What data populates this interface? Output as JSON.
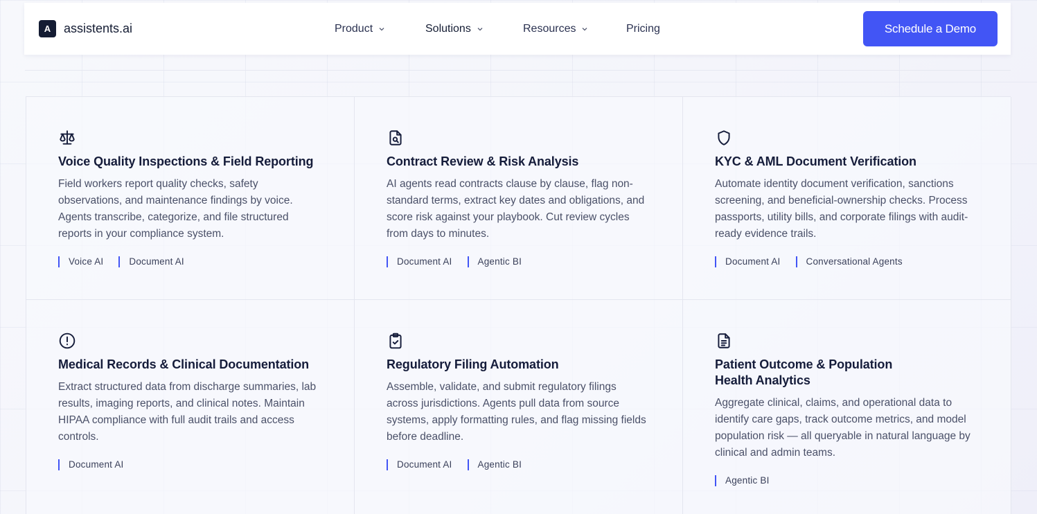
{
  "brand": {
    "mark": "A",
    "name": "assistents.ai"
  },
  "nav": {
    "items": [
      {
        "label": "Product"
      },
      {
        "label": "Solutions"
      },
      {
        "label": "Resources"
      },
      {
        "label": "Pricing"
      }
    ],
    "cta": "Schedule a Demo"
  },
  "colors": {
    "accent": "#4255f5",
    "ink": "#151c3a"
  },
  "cards": [
    {
      "icon": "scales-icon",
      "title": "Voice Quality Inspections & Field Reporting",
      "desc": "Field workers report quality checks, safety observations, and maintenance findings by voice. Agents transcribe, categorize, and file structured reports in your compliance system.",
      "tags": [
        "Voice AI",
        "Document AI"
      ]
    },
    {
      "icon": "file-search-icon",
      "title": "Contract Review & Risk Analysis",
      "desc": "AI agents read contracts clause by clause, flag non-standard terms, extract key dates and obligations, and score risk against your playbook. Cut review cycles from days to minutes.",
      "tags": [
        "Document AI",
        "Agentic BI"
      ]
    },
    {
      "icon": "shield-icon",
      "title": "KYC & AML Document Verification",
      "desc": "Automate identity document verification, sanctions screening, and beneficial-ownership checks. Process passports, utility bills, and corporate filings with audit-ready evidence trails.",
      "tags": [
        "Document AI",
        "Conversational Agents"
      ]
    },
    {
      "icon": "alert-circle-icon",
      "title": "Medical Records & Clinical Documentation",
      "desc": "Extract structured data from discharge summaries, lab results, imaging reports, and clinical notes. Maintain HIPAA compliance with full audit trails and access controls.",
      "tags": [
        "Document AI"
      ]
    },
    {
      "icon": "clipboard-check-icon",
      "title": "Regulatory Filing Automation",
      "desc": "Assemble, validate, and submit regulatory filings across jurisdictions. Agents pull data from source systems, apply formatting rules, and flag missing fields before deadline.",
      "tags": [
        "Document AI",
        "Agentic BI"
      ]
    },
    {
      "icon": "file-text-icon",
      "title": "Patient Outcome & Population Health Analytics",
      "desc": "Aggregate clinical, claims, and operational data to identify care gaps, track outcome metrics, and model population risk — all queryable in natural language by clinical and admin teams.",
      "tags": [
        "Agentic BI"
      ]
    }
  ]
}
